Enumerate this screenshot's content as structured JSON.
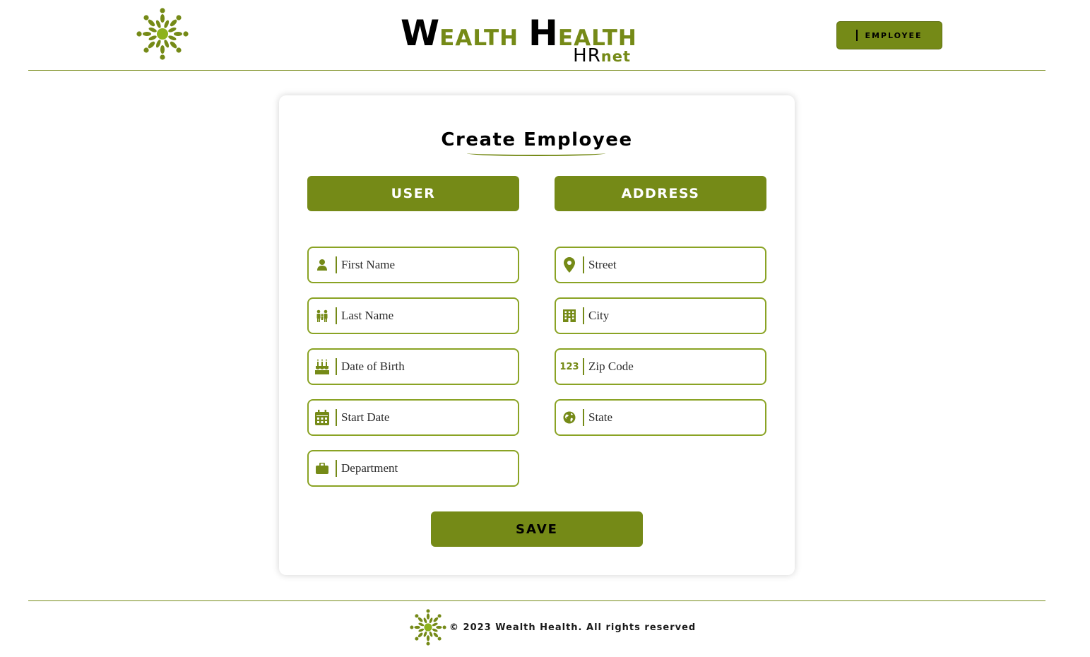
{
  "header": {
    "brand": {
      "word1_cap": "W",
      "word1_rest": "EALTH",
      "word2_cap": "H",
      "word2_rest": "EALTH",
      "sub_hr": "HR",
      "sub_net": "net"
    },
    "nav_button_label": "EMPLOYEE"
  },
  "form": {
    "title": "Create Employee",
    "sections": {
      "user_label": "USER",
      "address_label": "ADDRESS"
    },
    "user_fields": [
      {
        "placeholder": "First Name",
        "icon": "person-icon"
      },
      {
        "placeholder": "Last Name",
        "icon": "family-icon"
      },
      {
        "placeholder": "Date of Birth",
        "icon": "cake-icon"
      },
      {
        "placeholder": "Start Date",
        "icon": "calendar-icon"
      },
      {
        "placeholder": "Department",
        "icon": "briefcase-icon"
      }
    ],
    "address_fields": [
      {
        "placeholder": "Street",
        "icon": "location-pin-icon"
      },
      {
        "placeholder": "City",
        "icon": "building-icon"
      },
      {
        "placeholder": "Zip Code",
        "icon": "number-icon",
        "icon_text": "123"
      },
      {
        "placeholder": "State",
        "icon": "globe-icon"
      }
    ],
    "save_label": "SAVE"
  },
  "footer": {
    "text": "© 2023 Wealth Health. All rights reserved"
  },
  "colors": {
    "accent": "#758a17",
    "field_border": "#8aa324",
    "logo_light": "#8db21c"
  }
}
